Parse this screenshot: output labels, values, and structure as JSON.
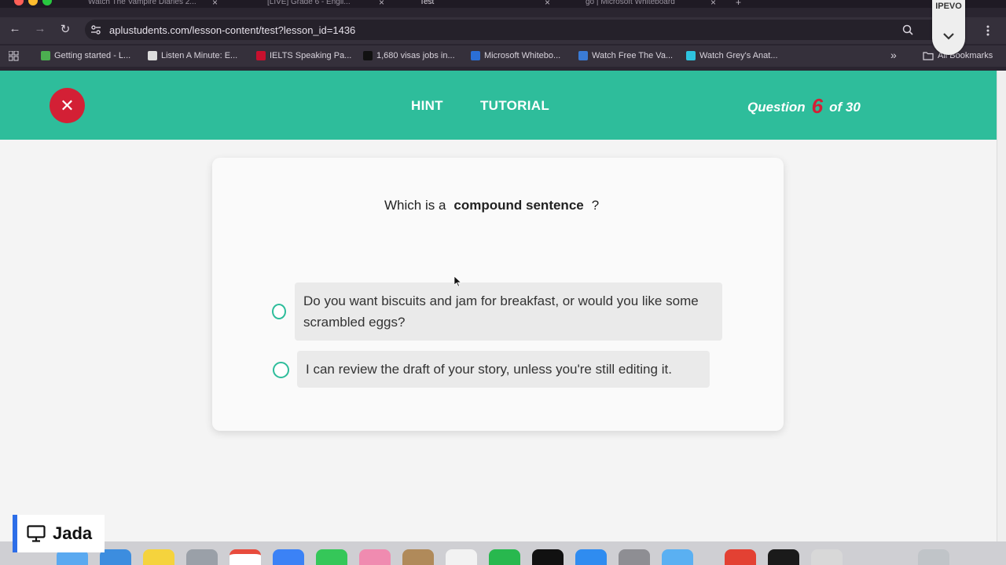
{
  "browser": {
    "tabs": [
      {
        "label": "Watch The Vampire Diaries 2..."
      },
      {
        "label": "[LIVE] Grade 6 - Engli..."
      },
      {
        "label": "Test"
      },
      {
        "label": "go | Microsoft Whiteboard"
      }
    ],
    "url": "aplustudents.com/lesson-content/test?lesson_id=1436",
    "bookmarks": [
      {
        "label": "Getting started - L..."
      },
      {
        "label": "Listen A Minute: E..."
      },
      {
        "label": "IELTS Speaking Pa..."
      },
      {
        "label": "1,680 visas jobs in..."
      },
      {
        "label": "Microsoft Whitebo..."
      },
      {
        "label": "Watch Free The Va..."
      },
      {
        "label": "Watch Grey's Anat..."
      }
    ],
    "all_bookmarks": "All Bookmarks",
    "overflow": "»",
    "ipevo_label": "IPEVO"
  },
  "header": {
    "close_glyph": "✕",
    "hint_label": "HINT",
    "tutorial_label": "TUTORIAL",
    "question_word": "Question",
    "question_number": "6",
    "question_total": "of 30"
  },
  "quiz": {
    "prompt_pre": "Which is a",
    "prompt_bold": "compound sentence",
    "prompt_post": "?",
    "options": [
      {
        "text": "Do you want biscuits and jam for breakfast, or would you like some scrambled eggs?"
      },
      {
        "text": "I can review the draft of your story, unless you're still editing it."
      }
    ]
  },
  "presenter": {
    "name": "Jada"
  },
  "colors": {
    "accent_green": "#2ebd9b",
    "close_red": "#d32035"
  }
}
